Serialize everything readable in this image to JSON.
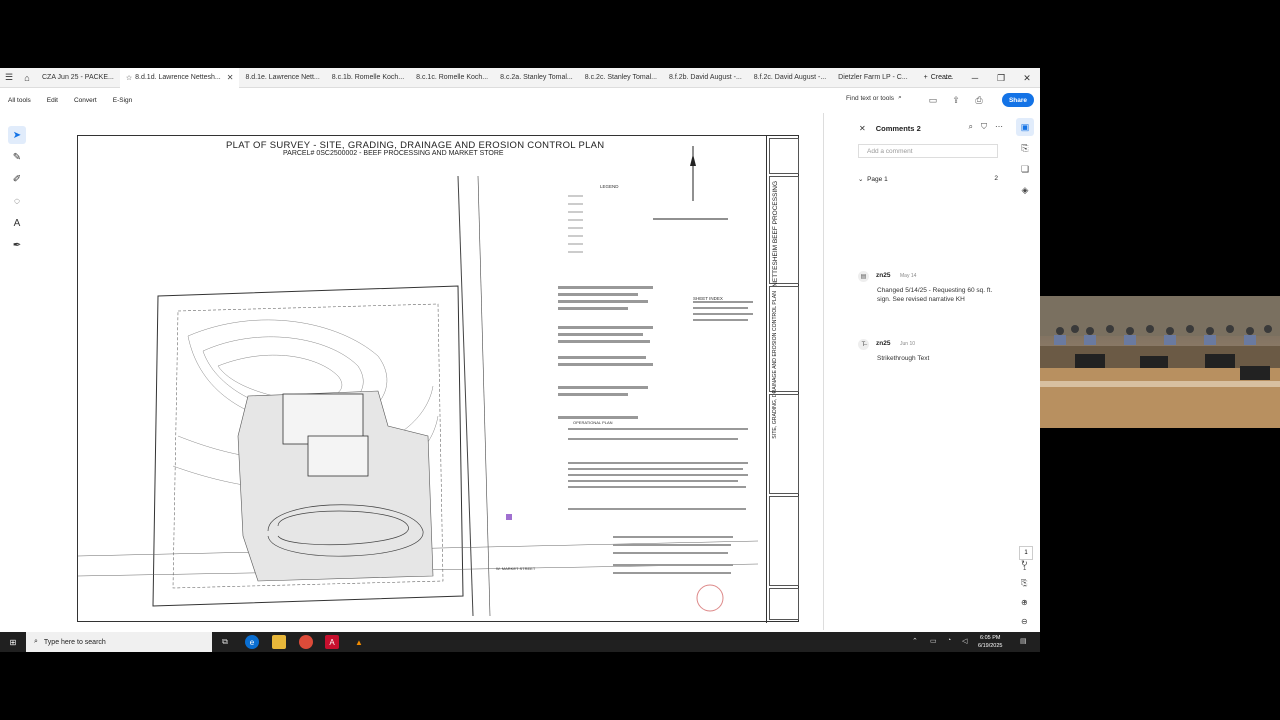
{
  "tabs": [
    {
      "label": "CZA Jun 25 - PACKE..."
    },
    {
      "label": "8.d.1d. Lawrence Nettesh...",
      "active": true
    },
    {
      "label": "8.d.1e. Lawrence Nett..."
    },
    {
      "label": "8.c.1b. Romelle Koch..."
    },
    {
      "label": "8.c.1c. Romelle Koch..."
    },
    {
      "label": "8.c.2a. Stanley Tomal..."
    },
    {
      "label": "8.c.2c. Stanley Tomal..."
    },
    {
      "label": "8.f.2b. David August -..."
    },
    {
      "label": "8.f.2c. David August -..."
    },
    {
      "label": "Dietzler Farm LP - C..."
    }
  ],
  "create_label": "Create",
  "menu": [
    "All tools",
    "Edit",
    "Convert",
    "E-Sign"
  ],
  "find_label": "Find text or tools",
  "share_label": "Share",
  "document": {
    "title": "PLAT OF SURVEY - SITE, GRADING, DRAINAGE AND EROSION CONTROL PLAN",
    "subtitle": "PARCEL# 0SC2500002 - BEEF PROCESSING AND MARKET STORE",
    "titleblock_1": "NETTESHEIM BEEF PROCESSING",
    "titleblock_2": "SITE, GRADING, DRAINAGE AND EROSION CONTROL PLAN",
    "legend_label": "LEGEND",
    "sheet_index_label": "SHEET INDEX",
    "street_label": "W. MARKET STREET",
    "notes_label": "OPERATIONAL PLAN"
  },
  "comments_panel": {
    "title": "Comments",
    "count": "2",
    "add_placeholder": "Add a comment",
    "page_label": "Page 1",
    "page_count": "2",
    "comments": [
      {
        "user": "zn25",
        "date": "May 14",
        "text": "Changed 5/14/25 - Requesting 60 sq. ft. sign. See revised narrative KH"
      },
      {
        "user": "zn25",
        "date": "Jun 10",
        "text": "Strikethrough Text"
      }
    ]
  },
  "page_nav": {
    "current": "1",
    "total": "1"
  },
  "taskbar": {
    "search_placeholder": "Type here to search",
    "time": "6:05 PM",
    "date": "6/19/2025"
  },
  "icons": [
    "menu-icon",
    "home-icon",
    "star-icon",
    "search-icon",
    "filter-icon",
    "share-icon",
    "print-icon",
    "upload-icon",
    "windows-icon",
    "edge-icon",
    "folder-icon",
    "chrome-icon",
    "acrobat-icon",
    "vlc-icon"
  ]
}
